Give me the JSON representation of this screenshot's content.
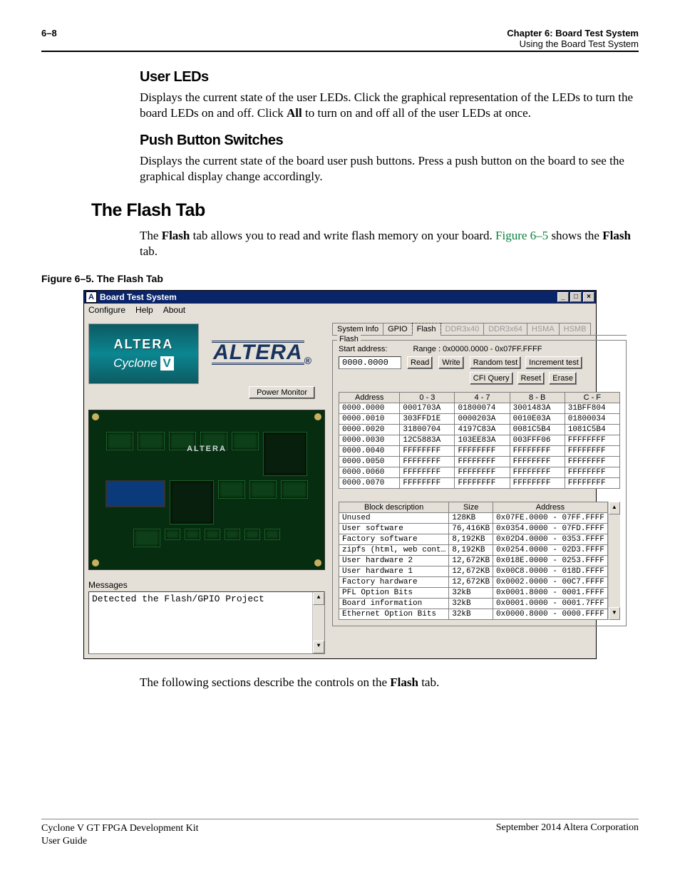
{
  "header": {
    "page": "6–8",
    "chapter": "Chapter 6:  Board Test System",
    "sub": "Using the Board Test System"
  },
  "sections": {
    "user_leds_h": "User LEDs",
    "user_leds_p1a": "Displays the current state of the user LEDs. Click the graphical representation of the LEDs to turn the board LEDs on and off. Click ",
    "user_leds_all": "All",
    "user_leds_p1b": " to turn on and off all of the user LEDs at once.",
    "push_h": "Push Button Switches",
    "push_p": "Displays the current state of the board user push buttons. Press a push button on the board to see the graphical display change accordingly.",
    "flash_h": "The Flash Tab",
    "flash_p1a": "The ",
    "flash_b1": "Flash",
    "flash_p1b": " tab allows you to read and write flash memory on your board. ",
    "flash_link": "Figure 6–5",
    "flash_p1c": " shows the ",
    "flash_b2": "Flash",
    "flash_p1d": " tab.",
    "fig_caption": "Figure 6–5.  The Flash Tab",
    "following_a": "The following sections describe the controls on the ",
    "following_b": "Flash",
    "following_c": " tab."
  },
  "app": {
    "title": "Board Test System",
    "menu": {
      "configure": "Configure",
      "help": "Help",
      "about": "About"
    },
    "altera_logo": "ALTERA",
    "badge_top": "ALTERA",
    "badge_bottom_a": "Cyclone",
    "badge_bottom_b": "V",
    "power_monitor_btn": "Power Monitor",
    "messages_label": "Messages",
    "messages_text": "Detected the Flash/GPIO Project",
    "tabs": {
      "sysinfo": "System Info",
      "gpio": "GPIO",
      "flash": "Flash",
      "ddr3x40": "DDR3x40",
      "ddr3x64": "DDR3x64",
      "hsma": "HSMA",
      "hsmb": "HSMB"
    },
    "flash_group": "Flash",
    "start_addr_label": "Start address:",
    "range_label": "Range :  0x0000.0000 - 0x07FF.FFFF",
    "start_addr_value": "0000.0000",
    "buttons": {
      "read": "Read",
      "write": "Write",
      "random": "Random test",
      "increment": "Increment test",
      "cfi": "CFI Query",
      "reset": "Reset",
      "erase": "Erase"
    },
    "mem_headers": {
      "addr": "Address",
      "c03": "0 - 3",
      "c47": "4 - 7",
      "c8b": "8 - B",
      "ccf": "C - F"
    },
    "mem_rows": [
      {
        "a": "0000.0000",
        "c0": "0001703A",
        "c1": "01800074",
        "c2": "3001483A",
        "c3": "31BFF804"
      },
      {
        "a": "0000.0010",
        "c0": "303FFD1E",
        "c1": "0000203A",
        "c2": "0010E03A",
        "c3": "01800034"
      },
      {
        "a": "0000.0020",
        "c0": "31800704",
        "c1": "4197C83A",
        "c2": "0081C5B4",
        "c3": "1081C5B4"
      },
      {
        "a": "0000.0030",
        "c0": "12C5883A",
        "c1": "103EE83A",
        "c2": "003FFF06",
        "c3": "FFFFFFFF"
      },
      {
        "a": "0000.0040",
        "c0": "FFFFFFFF",
        "c1": "FFFFFFFF",
        "c2": "FFFFFFFF",
        "c3": "FFFFFFFF"
      },
      {
        "a": "0000.0050",
        "c0": "FFFFFFFF",
        "c1": "FFFFFFFF",
        "c2": "FFFFFFFF",
        "c3": "FFFFFFFF"
      },
      {
        "a": "0000.0060",
        "c0": "FFFFFFFF",
        "c1": "FFFFFFFF",
        "c2": "FFFFFFFF",
        "c3": "FFFFFFFF"
      },
      {
        "a": "0000.0070",
        "c0": "FFFFFFFF",
        "c1": "FFFFFFFF",
        "c2": "FFFFFFFF",
        "c3": "FFFFFFFF"
      }
    ],
    "block_headers": {
      "desc": "Block description",
      "size": "Size",
      "addr": "Address"
    },
    "block_rows": [
      {
        "d": "Unused",
        "s": "128KB",
        "a": "0x07FE.0000 - 07FF.FFFF"
      },
      {
        "d": "User software",
        "s": "76,416KB",
        "a": "0x0354.0000 - 07FD.FFFF"
      },
      {
        "d": "Factory software",
        "s": "8,192KB",
        "a": "0x02D4.0000 - 0353.FFFF"
      },
      {
        "d": "zipfs (html, web cont…",
        "s": "8,192KB",
        "a": "0x0254.0000 - 02D3.FFFF"
      },
      {
        "d": "User hardware 2",
        "s": "12,672KB",
        "a": "0x018E.0000 - 0253.FFFF"
      },
      {
        "d": "User hardware 1",
        "s": "12,672KB",
        "a": "0x00C8.0000 - 018D.FFFF"
      },
      {
        "d": "Factory hardware",
        "s": "12,672KB",
        "a": "0x0002.0000 - 00C7.FFFF"
      },
      {
        "d": "PFL Option Bits",
        "s": "32kB",
        "a": "0x0001.8000 - 0001.FFFF"
      },
      {
        "d": "Board information",
        "s": "32kB",
        "a": "0x0001.0000 - 0001.7FFF"
      },
      {
        "d": "Ethernet Option Bits",
        "s": "32kB",
        "a": "0x0000.8000 - 0000.FFFF"
      }
    ]
  },
  "footer": {
    "left1": "Cyclone V GT FPGA Development Kit",
    "left2": "User Guide",
    "right": "September 2014    Altera Corporation"
  }
}
